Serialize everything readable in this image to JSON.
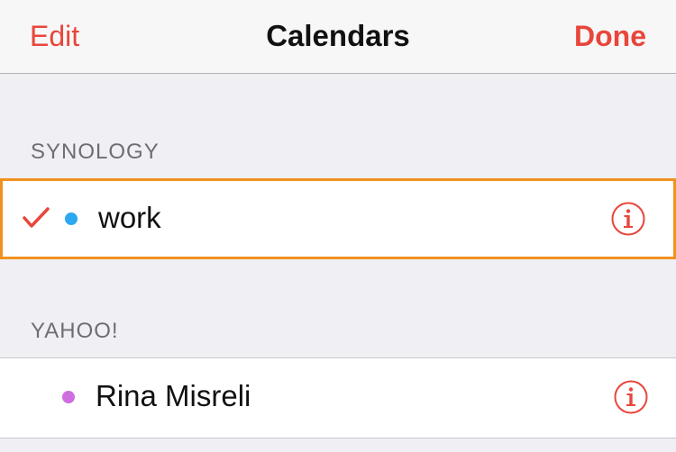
{
  "navbar": {
    "edit_label": "Edit",
    "title": "Calendars",
    "done_label": "Done"
  },
  "sections": [
    {
      "header": "SYNOLOGY",
      "calendars": [
        {
          "name": "work",
          "checked": true,
          "dot_color": "#2aa8f2",
          "highlighted": true
        }
      ]
    },
    {
      "header": "YAHOO!",
      "calendars": [
        {
          "name": "Rina Misreli",
          "checked": false,
          "dot_color": "#cf6ee0",
          "highlighted": false
        }
      ]
    }
  ],
  "colors": {
    "accent": "#e8463b",
    "highlight_border": "#f0921e",
    "group_background": "#efeff4"
  },
  "icons": {
    "checkmark": "checkmark-icon",
    "info": "info-icon"
  }
}
